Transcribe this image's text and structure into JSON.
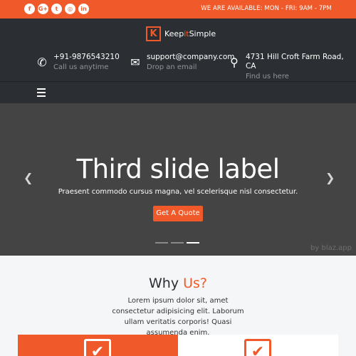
{
  "topbar": {
    "social": [
      {
        "icon": "facebook-icon",
        "glyph": "f"
      },
      {
        "icon": "google-plus-icon",
        "glyph": "G+"
      },
      {
        "icon": "twitter-icon",
        "glyph": "t"
      },
      {
        "icon": "instagram-icon",
        "glyph": "◎"
      },
      {
        "icon": "linkedin-icon",
        "glyph": "in"
      }
    ],
    "availability": "WE ARE AVAILABLE: MON - FRI: 9AM - 7PM"
  },
  "header": {
    "logo_letter": "K",
    "logo_part1": "Keep",
    "logo_part2": "it",
    "logo_part3": "Simple",
    "contacts": [
      {
        "icon": "phone-icon",
        "main": "+91-9876543210",
        "sub": "Call us anytime"
      },
      {
        "icon": "envelope-icon",
        "main": "support@company.com",
        "sub": "Drop an email"
      },
      {
        "icon": "location-pin-icon",
        "main": "4731 Hill Croft Farm Road, CA",
        "sub": "Find us here"
      }
    ]
  },
  "hero": {
    "title": "Third slide label",
    "subtitle": "Praesent commodo cursus magna, vel scelerisque nisl consectetur.",
    "button": "Get A Quote",
    "prev_glyph": "❮",
    "next_glyph": "❯",
    "slide_count": 3,
    "active_slide": 3,
    "watermark": "by blaz.app"
  },
  "why": {
    "title_part1": "Why ",
    "title_part2": "Us?",
    "text": "Lorem ipsum dolor sit, amet consectetur adipisicing elit. Laborum ullam veritatis corporis! Quasi assumenda enim.",
    "check_glyph": "✔"
  },
  "colors": {
    "accent": "#f05a2b",
    "header_bg": "#2b2f33",
    "hero_bg": "#444444"
  }
}
